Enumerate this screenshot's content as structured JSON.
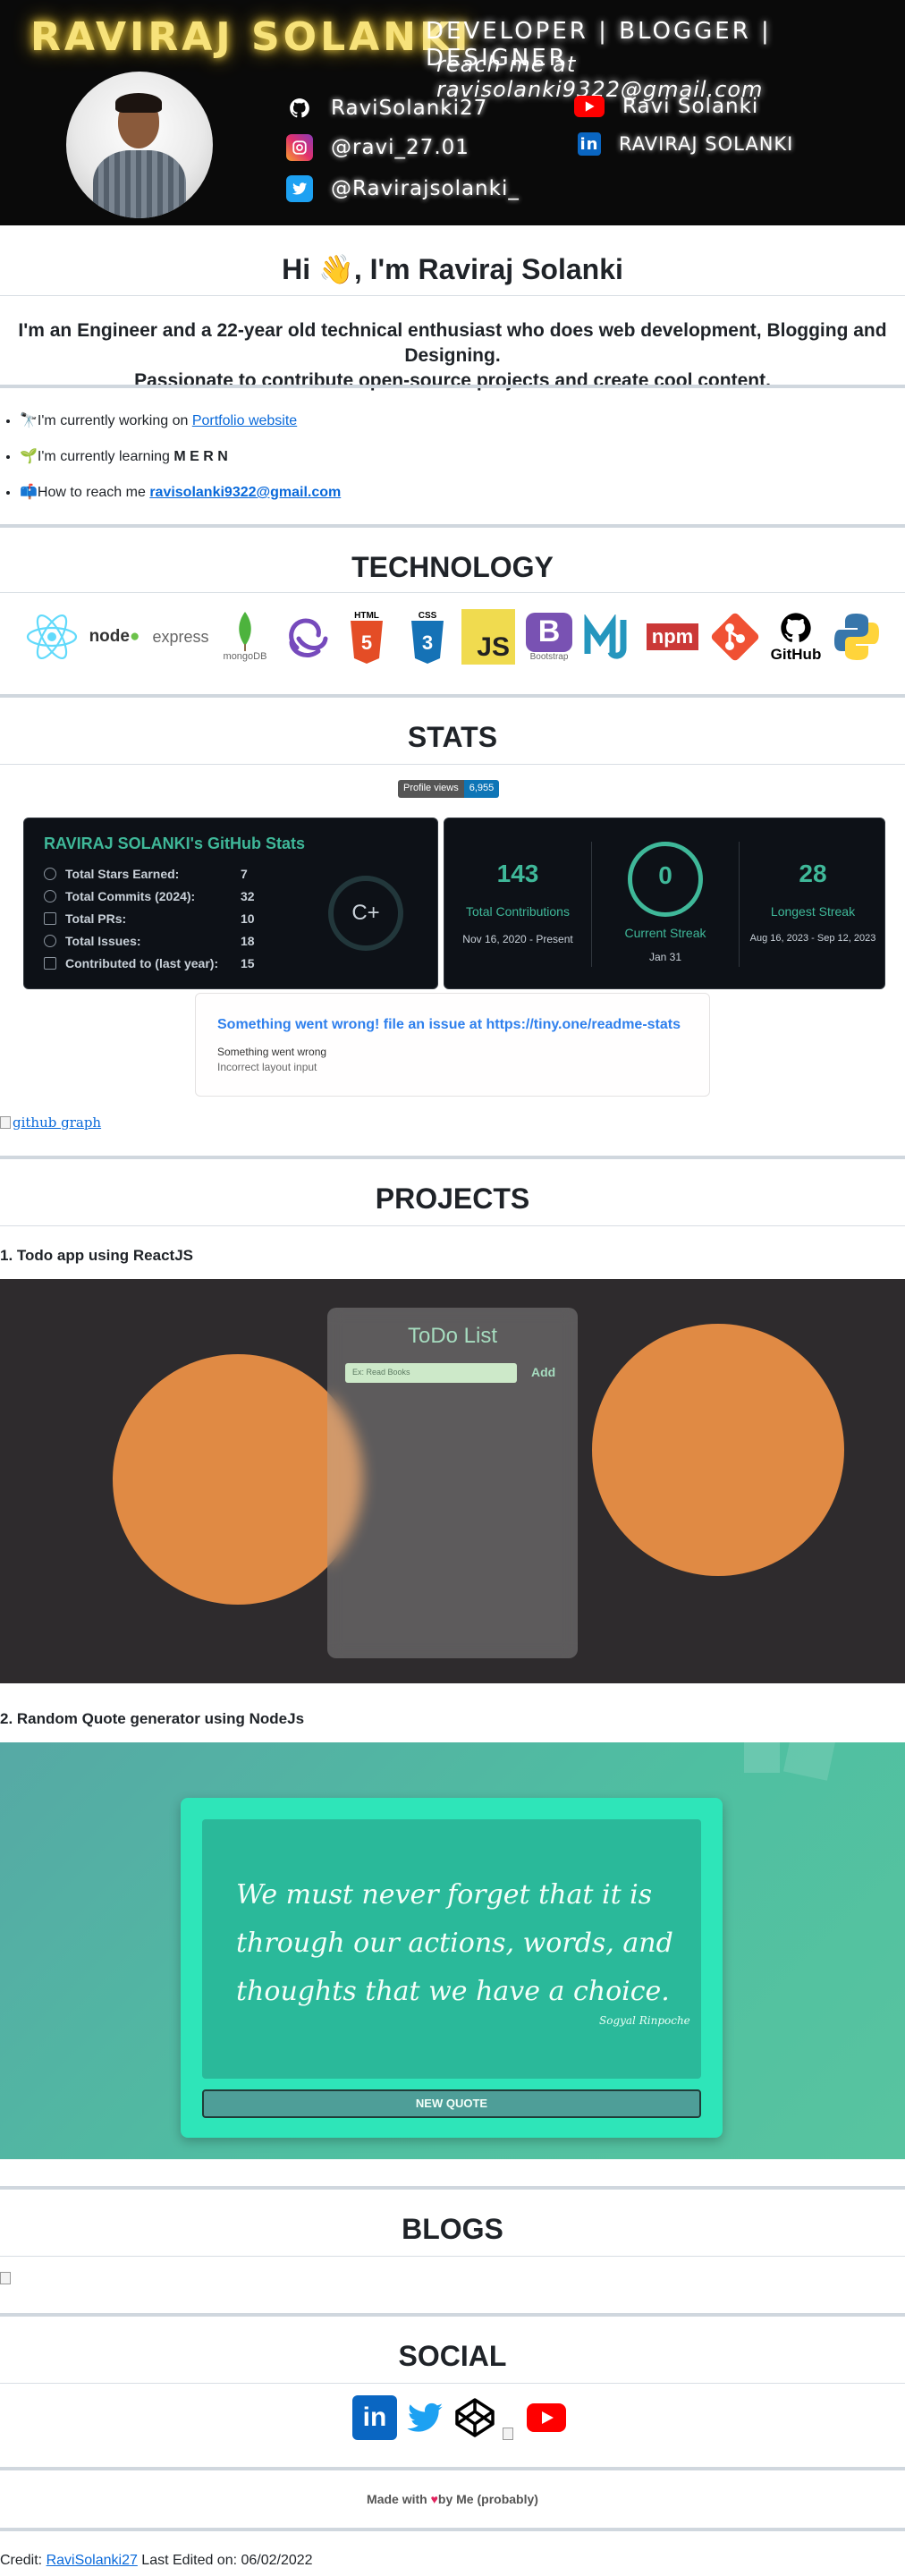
{
  "banner": {
    "name": "RAVIRAJ SOLANKI",
    "tagline": "DEVELOPER | BLOGGER | DESIGNER",
    "email_line": "reach me at ravisolanki9322@gmail.com",
    "links": [
      {
        "icon": "github-icon",
        "label": "RaviSolanki27"
      },
      {
        "icon": "instagram-icon",
        "label": "@ravi_27.01"
      },
      {
        "icon": "twitter-icon",
        "label": "@Ravirajsolanki_"
      },
      {
        "icon": "youtube-icon",
        "label": "Ravi Solanki"
      },
      {
        "icon": "linkedin-icon",
        "label": "RAVIRAJ SOLANKI"
      }
    ]
  },
  "intro": {
    "greeting": "Hi 👋, I'm Raviraj Solanki",
    "description_line1": "I'm an Engineer and a 22-year old technical enthusiast who does web development, Blogging and Designing.",
    "description_line2": "Passionate to contribute open-source projects and create cool content."
  },
  "bullets": [
    {
      "emoji": "🔭",
      "text": "I'm currently working on ",
      "link": "Portfolio website"
    },
    {
      "emoji": "🌱",
      "text": "I'm currently learning ",
      "bold": "M E R N"
    },
    {
      "emoji": "📫",
      "text": "How to reach me ",
      "link": "ravisolanki9322@gmail.com"
    }
  ],
  "technology": {
    "heading": "TECHNOLOGY",
    "items": [
      {
        "icon": "react-icon",
        "label": ""
      },
      {
        "icon": "nodejs-icon",
        "label": "node"
      },
      {
        "icon": "express-icon",
        "label": "express"
      },
      {
        "icon": "mongodb-icon",
        "label": "mongoDB"
      },
      {
        "icon": "redux-icon",
        "label": ""
      },
      {
        "icon": "html5-icon",
        "label": "HTML"
      },
      {
        "icon": "css3-icon",
        "label": "CSS"
      },
      {
        "icon": "javascript-icon",
        "label": "JS"
      },
      {
        "icon": "bootstrap-icon",
        "label": "Bootstrap"
      },
      {
        "icon": "materialize-icon",
        "label": ""
      },
      {
        "icon": "npm-icon",
        "label": "npm"
      },
      {
        "icon": "git-icon",
        "label": ""
      },
      {
        "icon": "github-icon",
        "label": "GitHub"
      },
      {
        "icon": "python-icon",
        "label": ""
      }
    ]
  },
  "stats": {
    "heading": "STATS",
    "profile_views_label": "Profile views",
    "profile_views_value": "6,955",
    "card_title": "RAVIRAJ SOLANKI's GitHub Stats",
    "rows": [
      {
        "label": "Total Stars Earned:",
        "value": "7"
      },
      {
        "label": "Total Commits (2024):",
        "value": "32"
      },
      {
        "label": "Total PRs:",
        "value": "10"
      },
      {
        "label": "Total Issues:",
        "value": "18"
      },
      {
        "label": "Contributed to (last year):",
        "value": "15"
      }
    ],
    "grade": "C+",
    "streak": [
      {
        "value": "143",
        "label": "Total Contributions",
        "sub": "Nov 16, 2020 - Present"
      },
      {
        "value": "0",
        "label": "Current Streak",
        "sub": "Jan 31"
      },
      {
        "value": "28",
        "label": "Longest Streak",
        "sub": "Aug 16, 2023 - Sep 12, 2023"
      }
    ],
    "error_title": "Something went wrong! file an issue at https://tiny.one/readme-stats",
    "error_line1": "Something went wrong",
    "error_line2": "Incorrect layout input",
    "graph_alt": "github graph"
  },
  "projects": {
    "heading": "PROJECTS",
    "items": [
      {
        "title": "1. Todo app using ReactJS",
        "app_title": "ToDo List",
        "input_placeholder": "Ex: Read Books",
        "add_label": "Add"
      },
      {
        "title": "2. Random Quote generator using NodeJs",
        "quote": "We must never forget that it is through our actions, words, and thoughts that we have a choice.",
        "author": "Sogyal Rinpoche",
        "button": "NEW QUOTE"
      }
    ]
  },
  "blogs": {
    "heading": "BLOGS"
  },
  "social": {
    "heading": "SOCIAL",
    "icons": [
      "linkedin-icon",
      "twitter-icon",
      "codepen-icon",
      "broken-image-icon",
      "youtube-icon"
    ]
  },
  "footer": {
    "made_with_prefix": "Made with ",
    "made_with_suffix": "by Me (probably)",
    "credit_prefix": "Credit: ",
    "credit_link": "RaviSolanki27",
    "credit_suffix": " Last Edited on: 06/02/2022"
  },
  "colors": {
    "banner_bg": "#0a0a0a",
    "banner_name": "#f7e27a",
    "stats_accent": "#3fb899",
    "link": "#0969da",
    "todo_bg": "#2e2b2d",
    "todo_orange": "#e08a44",
    "quote_card": "#2ee5b9"
  }
}
